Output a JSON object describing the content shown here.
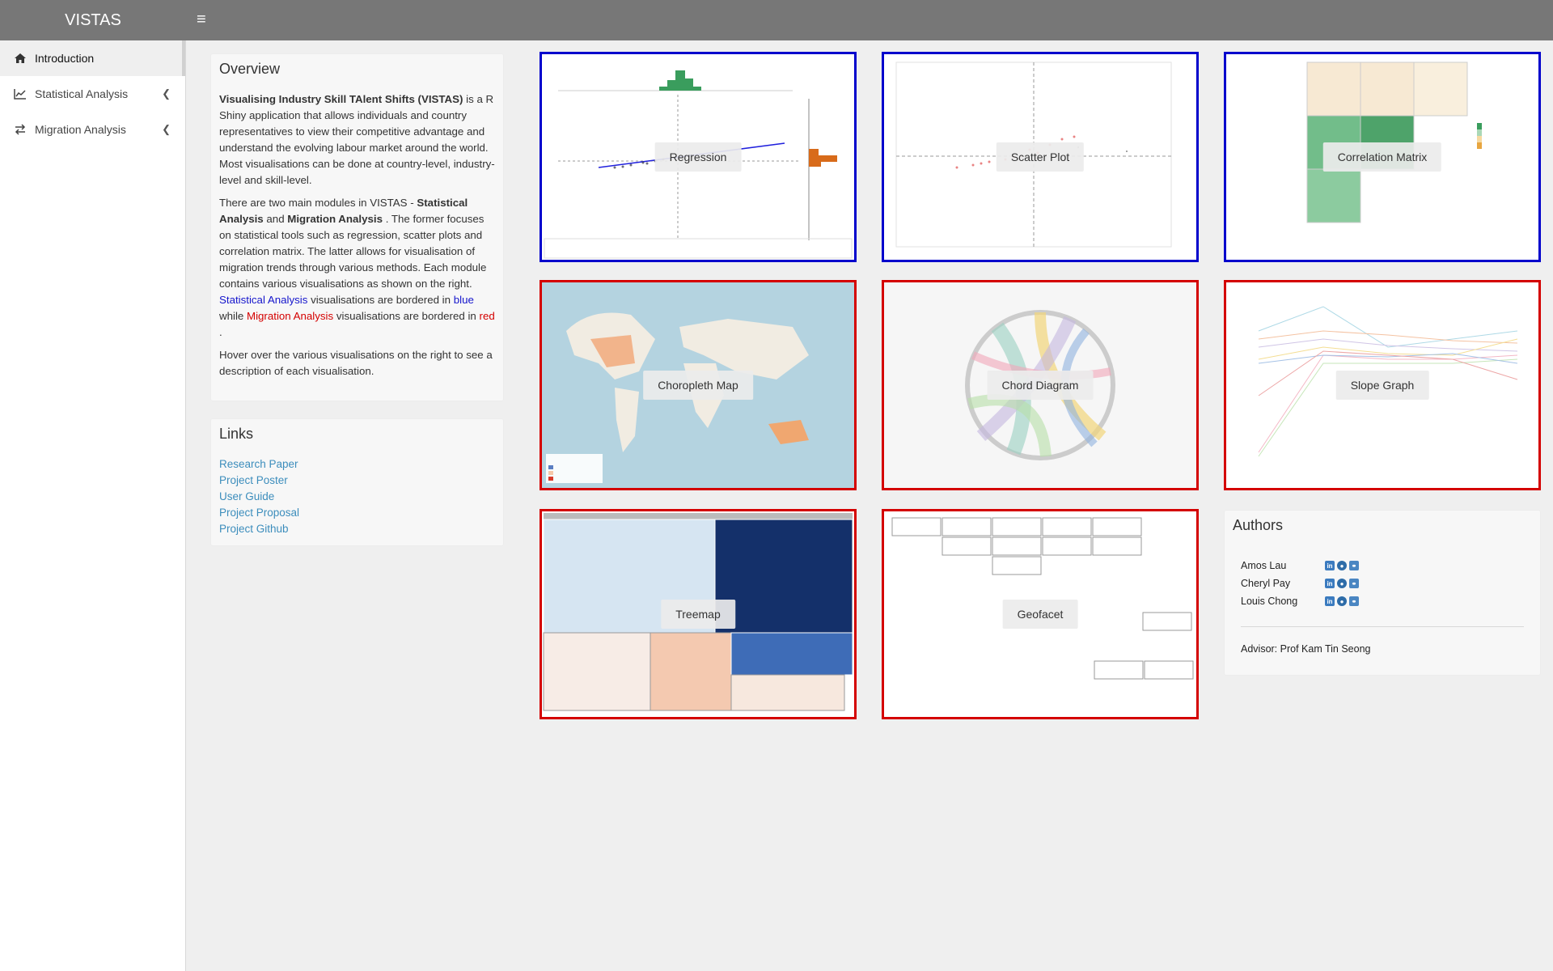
{
  "app": {
    "title": "VISTAS",
    "menu_icon": "hamburger-icon"
  },
  "sidebar": {
    "items": [
      {
        "label": "Introduction",
        "icon": "home-icon",
        "active": true
      },
      {
        "label": "Statistical Analysis",
        "icon": "line-chart-icon",
        "expandable": true
      },
      {
        "label": "Migration Analysis",
        "icon": "exchange-icon",
        "expandable": true
      }
    ]
  },
  "overview": {
    "title": "Overview",
    "p1_bold": "Visualising Industry Skill TAlent Shifts (VISTAS)",
    "p1_rest": " is a R Shiny application that allows individuals and country representatives to view their competitive advantage and understand the evolving labour market around the world. Most visualisations can be done at country-level, industry-level and skill-level.",
    "p2_a": "There are two main modules in VISTAS - ",
    "p2_b": "Statistical Analysis",
    "p2_c": " and ",
    "p2_d": "Migration Analysis",
    "p2_e": " . The former focuses on statistical tools such as regression, scatter plots and correlation matrix. The latter allows for visualisation of migration trends through various methods. Each module contains various visualisations as shown on the right. ",
    "p2_f": "Statistical Analysis",
    "p2_g": " visualisations are bordered in ",
    "p2_h": "blue",
    "p2_i": " while ",
    "p2_j": "Migration Analysis",
    "p2_k": " visualisations are bordered in ",
    "p2_l": "red",
    "p2_m": " .",
    "p3": "Hover over the various visualisations on the right to see a description of each visualisation."
  },
  "links": {
    "title": "Links",
    "items": [
      "Research Paper",
      "Project Poster",
      "User Guide",
      "Project Proposal",
      "Project Github"
    ]
  },
  "visualisations": [
    {
      "label": "Regression",
      "module": "statistical"
    },
    {
      "label": "Scatter Plot",
      "module": "statistical"
    },
    {
      "label": "Correlation Matrix",
      "module": "statistical"
    },
    {
      "label": "Choropleth Map",
      "module": "migration"
    },
    {
      "label": "Chord Diagram",
      "module": "migration"
    },
    {
      "label": "Slope Graph",
      "module": "migration"
    },
    {
      "label": "Treemap",
      "module": "migration"
    },
    {
      "label": "Geofacet",
      "module": "migration"
    }
  ],
  "colors": {
    "statistical_border": "#0000cc",
    "migration_border": "#d40000",
    "link": "#3c8dbc",
    "topbar": "#777777"
  },
  "authors": {
    "title": "Authors",
    "people": [
      {
        "name": "Amos Lau",
        "icons": [
          "linkedin-icon",
          "github-icon",
          "researchgate-icon"
        ]
      },
      {
        "name": "Cheryl Pay",
        "icons": [
          "linkedin-icon",
          "github-icon",
          "researchgate-icon"
        ]
      },
      {
        "name": "Louis Chong",
        "icons": [
          "linkedin-icon",
          "github-icon",
          "researchgate-icon"
        ]
      }
    ],
    "advisor": "Advisor: Prof Kam Tin Seong"
  }
}
